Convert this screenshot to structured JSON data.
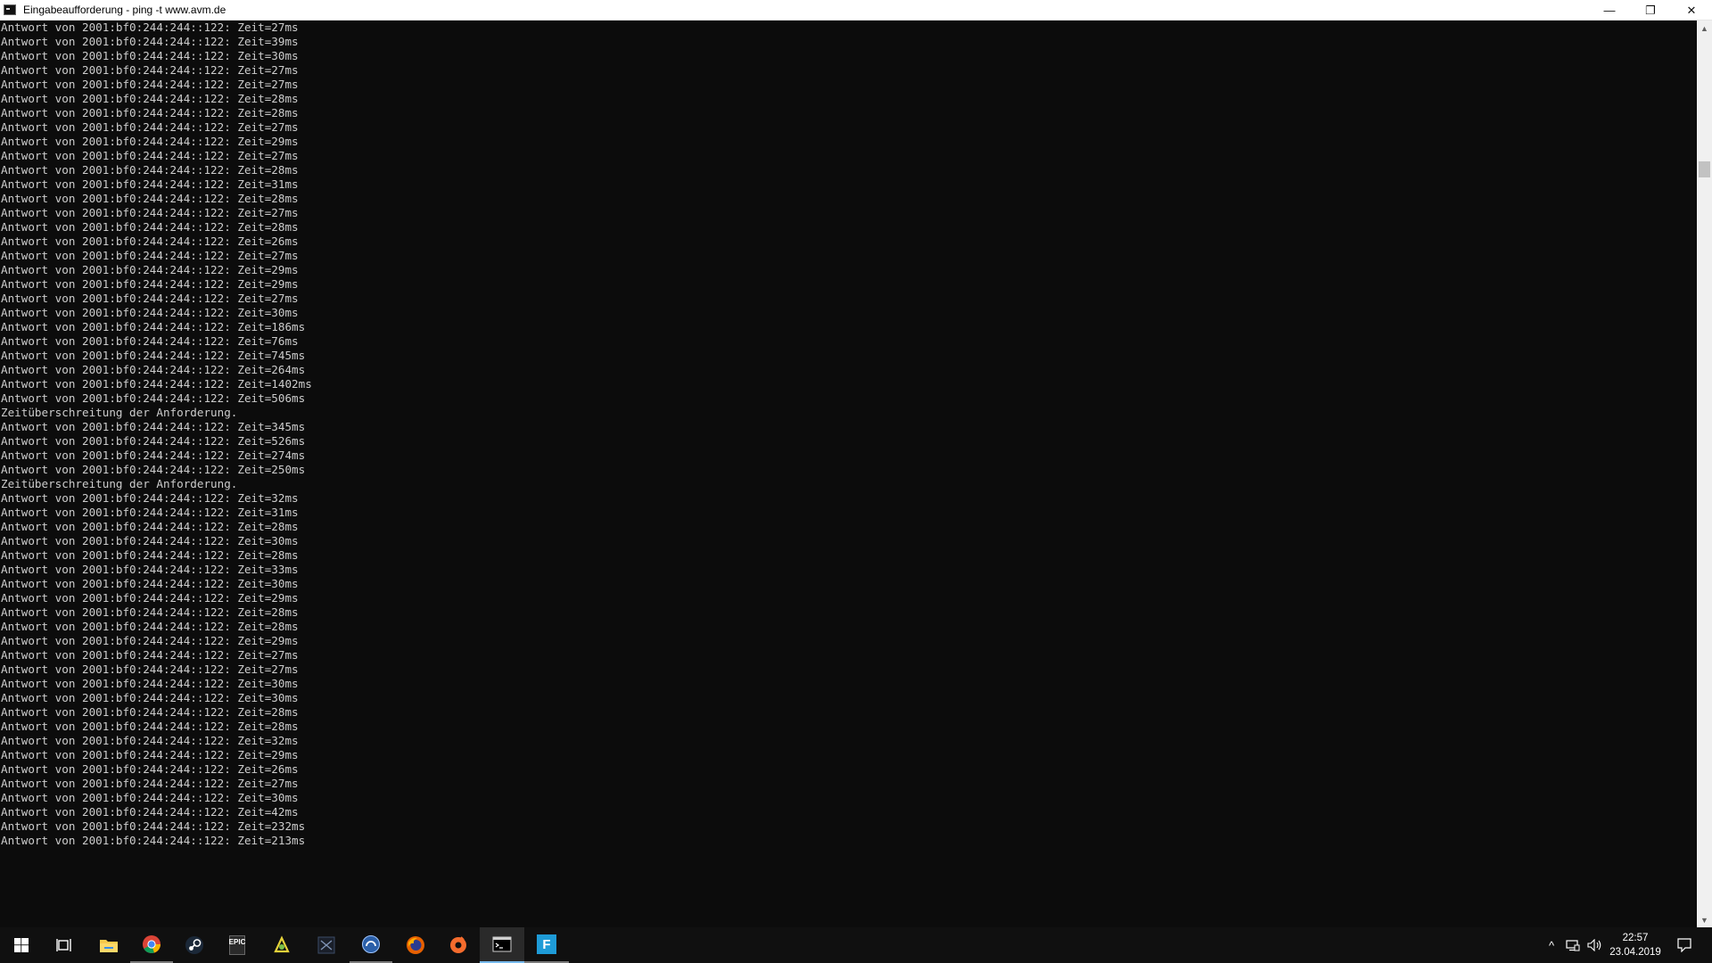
{
  "window": {
    "title": "Eingabeaufforderung - ping  -t www.avm.de",
    "minimize_glyph": "—",
    "restore_glyph": "❐",
    "close_glyph": "✕"
  },
  "console": {
    "lines": [
      "Antwort von 2001:bf0:244:244::122: Zeit=27ms",
      "Antwort von 2001:bf0:244:244::122: Zeit=39ms",
      "Antwort von 2001:bf0:244:244::122: Zeit=30ms",
      "Antwort von 2001:bf0:244:244::122: Zeit=27ms",
      "Antwort von 2001:bf0:244:244::122: Zeit=27ms",
      "Antwort von 2001:bf0:244:244::122: Zeit=28ms",
      "Antwort von 2001:bf0:244:244::122: Zeit=28ms",
      "Antwort von 2001:bf0:244:244::122: Zeit=27ms",
      "Antwort von 2001:bf0:244:244::122: Zeit=29ms",
      "Antwort von 2001:bf0:244:244::122: Zeit=27ms",
      "Antwort von 2001:bf0:244:244::122: Zeit=28ms",
      "Antwort von 2001:bf0:244:244::122: Zeit=31ms",
      "Antwort von 2001:bf0:244:244::122: Zeit=28ms",
      "Antwort von 2001:bf0:244:244::122: Zeit=27ms",
      "Antwort von 2001:bf0:244:244::122: Zeit=28ms",
      "Antwort von 2001:bf0:244:244::122: Zeit=26ms",
      "Antwort von 2001:bf0:244:244::122: Zeit=27ms",
      "Antwort von 2001:bf0:244:244::122: Zeit=29ms",
      "Antwort von 2001:bf0:244:244::122: Zeit=29ms",
      "Antwort von 2001:bf0:244:244::122: Zeit=27ms",
      "Antwort von 2001:bf0:244:244::122: Zeit=30ms",
      "Antwort von 2001:bf0:244:244::122: Zeit=186ms",
      "Antwort von 2001:bf0:244:244::122: Zeit=76ms",
      "Antwort von 2001:bf0:244:244::122: Zeit=745ms",
      "Antwort von 2001:bf0:244:244::122: Zeit=264ms",
      "Antwort von 2001:bf0:244:244::122: Zeit=1402ms",
      "Antwort von 2001:bf0:244:244::122: Zeit=506ms",
      "Zeitüberschreitung der Anforderung.",
      "Antwort von 2001:bf0:244:244::122: Zeit=345ms",
      "Antwort von 2001:bf0:244:244::122: Zeit=526ms",
      "Antwort von 2001:bf0:244:244::122: Zeit=274ms",
      "Antwort von 2001:bf0:244:244::122: Zeit=250ms",
      "Zeitüberschreitung der Anforderung.",
      "Antwort von 2001:bf0:244:244::122: Zeit=32ms",
      "Antwort von 2001:bf0:244:244::122: Zeit=31ms",
      "Antwort von 2001:bf0:244:244::122: Zeit=28ms",
      "Antwort von 2001:bf0:244:244::122: Zeit=30ms",
      "Antwort von 2001:bf0:244:244::122: Zeit=28ms",
      "Antwort von 2001:bf0:244:244::122: Zeit=33ms",
      "Antwort von 2001:bf0:244:244::122: Zeit=30ms",
      "Antwort von 2001:bf0:244:244::122: Zeit=29ms",
      "Antwort von 2001:bf0:244:244::122: Zeit=28ms",
      "Antwort von 2001:bf0:244:244::122: Zeit=28ms",
      "Antwort von 2001:bf0:244:244::122: Zeit=29ms",
      "Antwort von 2001:bf0:244:244::122: Zeit=27ms",
      "Antwort von 2001:bf0:244:244::122: Zeit=27ms",
      "Antwort von 2001:bf0:244:244::122: Zeit=30ms",
      "Antwort von 2001:bf0:244:244::122: Zeit=30ms",
      "Antwort von 2001:bf0:244:244::122: Zeit=28ms",
      "Antwort von 2001:bf0:244:244::122: Zeit=28ms",
      "Antwort von 2001:bf0:244:244::122: Zeit=32ms",
      "Antwort von 2001:bf0:244:244::122: Zeit=29ms",
      "Antwort von 2001:bf0:244:244::122: Zeit=26ms",
      "Antwort von 2001:bf0:244:244::122: Zeit=27ms",
      "Antwort von 2001:bf0:244:244::122: Zeit=30ms",
      "Antwort von 2001:bf0:244:244::122: Zeit=42ms",
      "Antwort von 2001:bf0:244:244::122: Zeit=232ms",
      "Antwort von 2001:bf0:244:244::122: Zeit=213ms"
    ]
  },
  "taskbar": {
    "apps": [
      {
        "name": "start-button",
        "icon": "windows-logo-icon",
        "state": "none"
      },
      {
        "name": "task-view-button",
        "icon": "task-view-icon",
        "state": "none"
      },
      {
        "name": "file-explorer-button",
        "icon": "folder-icon",
        "state": "none"
      },
      {
        "name": "chrome-button",
        "icon": "chrome-icon",
        "state": "running"
      },
      {
        "name": "steam-button",
        "icon": "steam-icon",
        "state": "none"
      },
      {
        "name": "epic-games-button",
        "icon": "epic-games-icon",
        "state": "none"
      },
      {
        "name": "app-yellow-button",
        "icon": "yellow-app-icon",
        "state": "none"
      },
      {
        "name": "app-dark-button",
        "icon": "dark-app-icon",
        "state": "none"
      },
      {
        "name": "app-blue-circle-button",
        "icon": "blue-circle-icon",
        "state": "running"
      },
      {
        "name": "firefox-button",
        "icon": "firefox-icon",
        "state": "none"
      },
      {
        "name": "origin-button",
        "icon": "origin-icon",
        "state": "none"
      },
      {
        "name": "command-prompt-button",
        "icon": "command-prompt-icon",
        "state": "active"
      },
      {
        "name": "blue-f-app-button",
        "icon": "blue-f-icon",
        "state": "running"
      }
    ],
    "epic_label": "EPIC",
    "f_label": "F",
    "tray": {
      "chevron": "^",
      "time": "22:57",
      "date": "23.04.2019"
    }
  },
  "colors": {
    "console_bg": "#0c0c0c",
    "console_text": "#cccccc",
    "taskbar_bg": "#101010",
    "accent": "#76b9ed"
  }
}
